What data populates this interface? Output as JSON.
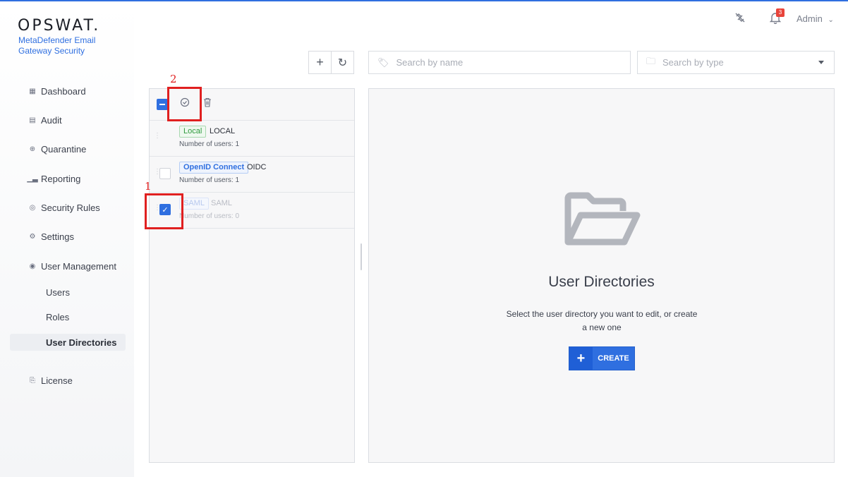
{
  "brand": {
    "logo": "OPSWAT.",
    "product": "MetaDefender Email Gateway Security"
  },
  "topbar": {
    "notification_count": "3",
    "user": "Admin",
    "icons": [
      "unlink-icon",
      "bell-icon",
      "chevron-down-icon"
    ]
  },
  "sidebar": {
    "items": [
      {
        "label": "Dashboard",
        "icon": "grid-icon"
      },
      {
        "label": "Audit",
        "icon": "audit-icon"
      },
      {
        "label": "Quarantine",
        "icon": "quarantine-icon"
      },
      {
        "label": "Reporting",
        "icon": "chart-icon"
      },
      {
        "label": "Security Rules",
        "icon": "shield-icon"
      },
      {
        "label": "Settings",
        "icon": "gear-icon"
      },
      {
        "label": "User Management",
        "icon": "user-icon"
      },
      {
        "label": "License",
        "icon": "license-icon"
      }
    ],
    "sub_items": [
      "Users",
      "Roles",
      "User Directories"
    ],
    "active": "User Directories"
  },
  "toolbar": {
    "search_name_placeholder": "Search by name",
    "search_type_placeholder": "Search by type"
  },
  "directories": [
    {
      "type": "Local",
      "name": "LOCAL",
      "users": "Number of users: 1",
      "checked": false
    },
    {
      "type": "OpenID Connect",
      "name": "OIDC",
      "users": "Number of users: 1",
      "checked": false
    },
    {
      "type": "SAML",
      "name": "SAML",
      "users": "Number of users: 0",
      "checked": true
    }
  ],
  "empty_state": {
    "title": "User Directories",
    "description": "Select the user directory you want to edit, or create a new one",
    "create_label": "CREATE"
  },
  "annotations": [
    "1",
    "2"
  ],
  "colors": {
    "accent": "#2f6fe0",
    "annotation": "#e02020"
  }
}
